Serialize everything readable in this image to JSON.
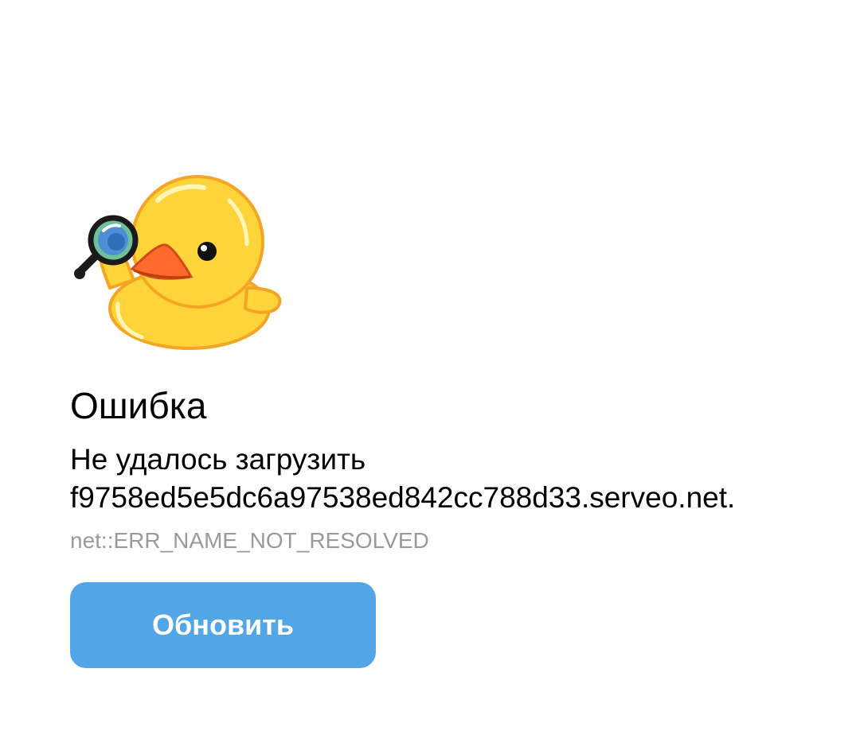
{
  "error": {
    "sticker_icon": "duck-with-magnifier-icon",
    "title": "Ошибка",
    "message_prefix": "Не удалось загрузить ",
    "host": "f9758ed5e5dc6a97538ed842cc788d33.serveo.net",
    "message_suffix": ".",
    "code": "net::ERR_NAME_NOT_RESOLVED"
  },
  "actions": {
    "reload_label": "Обновить"
  },
  "colors": {
    "button": "#53a6e5",
    "duck": "#ffd43a",
    "beak": "#ff6a2c",
    "error_code": "#9a9a9a"
  }
}
